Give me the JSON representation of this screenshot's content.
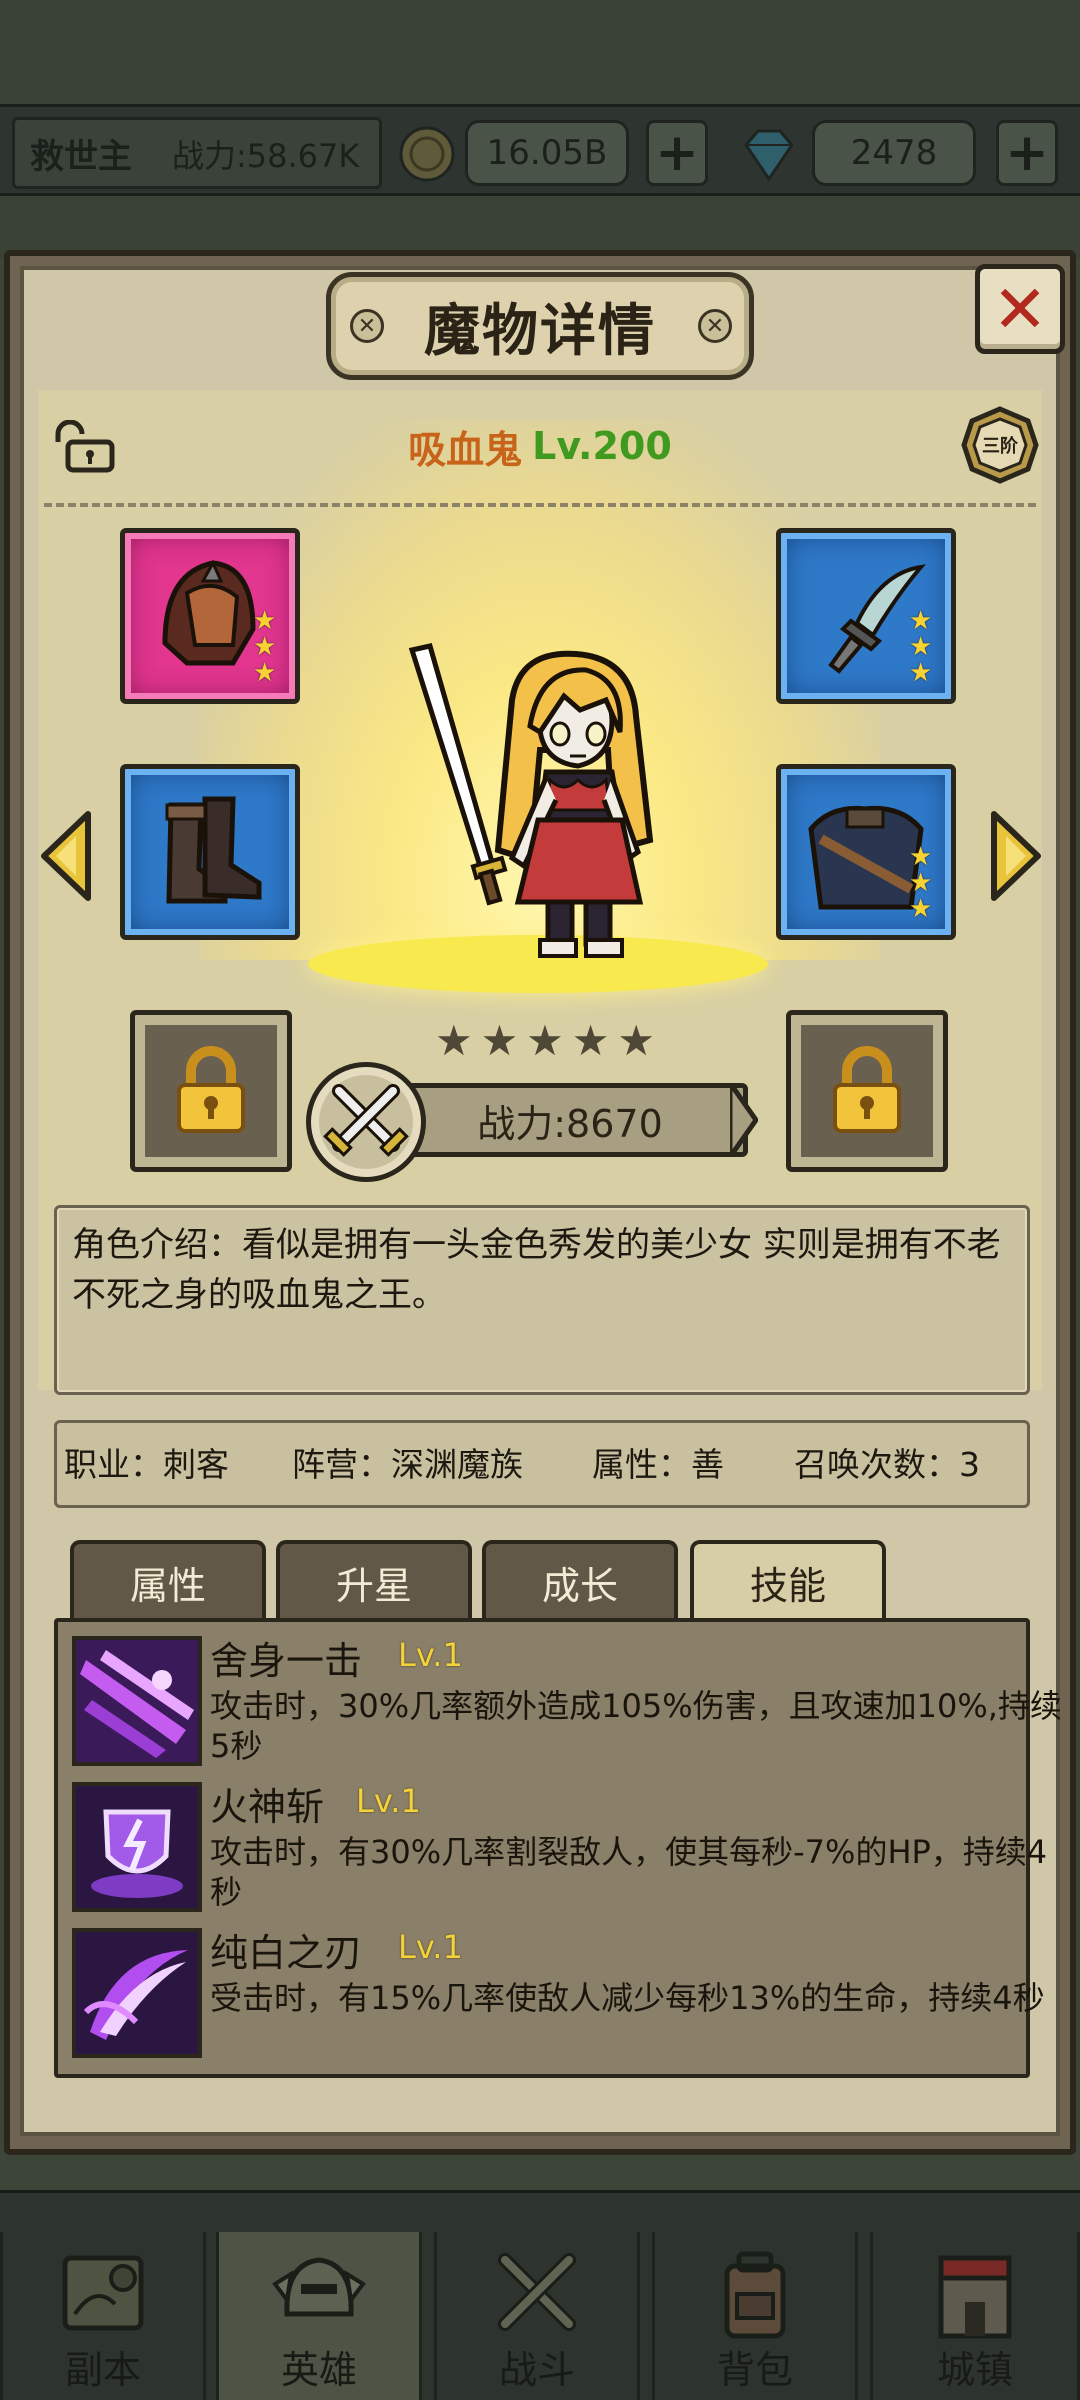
{
  "top_bar": {
    "player_name": "救世主",
    "power": "战力:58.67K",
    "gold": "16.05B",
    "diamonds": "2478",
    "plus": "+"
  },
  "dialog": {
    "title": "魔物详情",
    "close": "✕",
    "bolt": "✕"
  },
  "hero": {
    "name": "吸血鬼",
    "level": "Lv.200",
    "tier": "三阶",
    "stars_total": 5,
    "power": "战力:8670",
    "equipment": [
      {
        "slot": "helmet",
        "rarity_color": "#e2368f",
        "stars": 3
      },
      {
        "slot": "weapon",
        "rarity_color": "#2f79c9",
        "stars": 3
      },
      {
        "slot": "boots",
        "rarity_color": "#2f79c9",
        "stars": 0
      },
      {
        "slot": "armor",
        "rarity_color": "#2f79c9",
        "stars": 3
      }
    ],
    "description": "角色介绍：看似是拥有一头金色秀发的美少女 实则是拥有不老不死之身的吸血鬼之王。",
    "info": {
      "job": "职业：刺客",
      "faction": "阵营：深渊魔族",
      "attribute": "属性：善",
      "summons": "召唤次数：3"
    }
  },
  "tabs": [
    {
      "label": "属性"
    },
    {
      "label": "升星"
    },
    {
      "label": "成长"
    },
    {
      "label": "技能"
    }
  ],
  "skills": [
    {
      "name": "舍身一击",
      "level": "Lv.1",
      "desc": "攻击时，30%几率额外造成105%伤害，且攻速加10%,持续5秒",
      "icon": "sword-burst-icon"
    },
    {
      "name": "火神斩",
      "level": "Lv.1",
      "desc": "攻击时，有30%几率割裂敌人，使其每秒-7%的HP，持续4秒",
      "icon": "shield-crack-icon"
    },
    {
      "name": "纯白之刃",
      "level": "Lv.1",
      "desc": "受击时，有15%几率使敌人减少每秒13%的生命，持续4秒",
      "icon": "slash-arc-icon"
    }
  ],
  "nav": [
    {
      "label": "副本",
      "icon": "map-scroll-icon"
    },
    {
      "label": "英雄",
      "icon": "helmet-icon"
    },
    {
      "label": "战斗",
      "icon": "crossed-swords-icon"
    },
    {
      "label": "背包",
      "icon": "backpack-icon"
    },
    {
      "label": "城镇",
      "icon": "castle-icon"
    }
  ],
  "colors": {
    "pink_rarity": "#e2368f",
    "blue_rarity": "#2f79c9",
    "skill_level": "#f3d23b",
    "hero_name": "#c8641a",
    "hero_level": "#3f9a1f"
  }
}
